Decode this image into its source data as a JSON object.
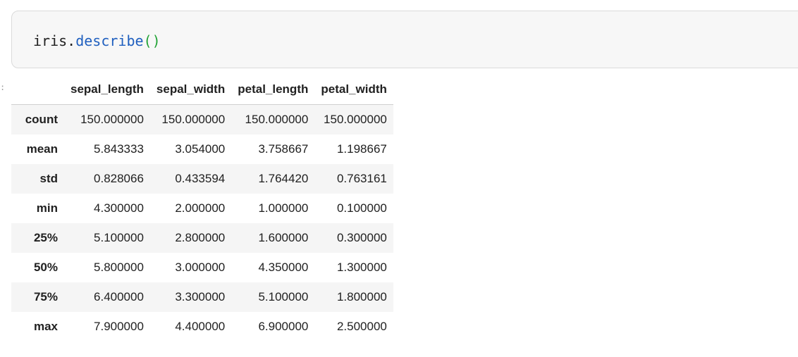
{
  "code_cell": {
    "object": "iris",
    "dot": ".",
    "method": "describe",
    "parens": "()"
  },
  "gutter": {
    "mark": ":"
  },
  "table": {
    "columns": [
      "sepal_length",
      "sepal_width",
      "petal_length",
      "petal_width"
    ],
    "rows": [
      {
        "label": "count",
        "values": [
          "150.000000",
          "150.000000",
          "150.000000",
          "150.000000"
        ]
      },
      {
        "label": "mean",
        "values": [
          "5.843333",
          "3.054000",
          "3.758667",
          "1.198667"
        ]
      },
      {
        "label": "std",
        "values": [
          "0.828066",
          "0.433594",
          "1.764420",
          "0.763161"
        ]
      },
      {
        "label": "min",
        "values": [
          "4.300000",
          "2.000000",
          "1.000000",
          "0.100000"
        ]
      },
      {
        "label": "25%",
        "values": [
          "5.100000",
          "2.800000",
          "1.600000",
          "0.300000"
        ]
      },
      {
        "label": "50%",
        "values": [
          "5.800000",
          "3.000000",
          "4.350000",
          "1.300000"
        ]
      },
      {
        "label": "75%",
        "values": [
          "6.400000",
          "3.300000",
          "5.100000",
          "1.800000"
        ]
      },
      {
        "label": "max",
        "values": [
          "7.900000",
          "4.400000",
          "6.900000",
          "2.500000"
        ]
      }
    ]
  }
}
